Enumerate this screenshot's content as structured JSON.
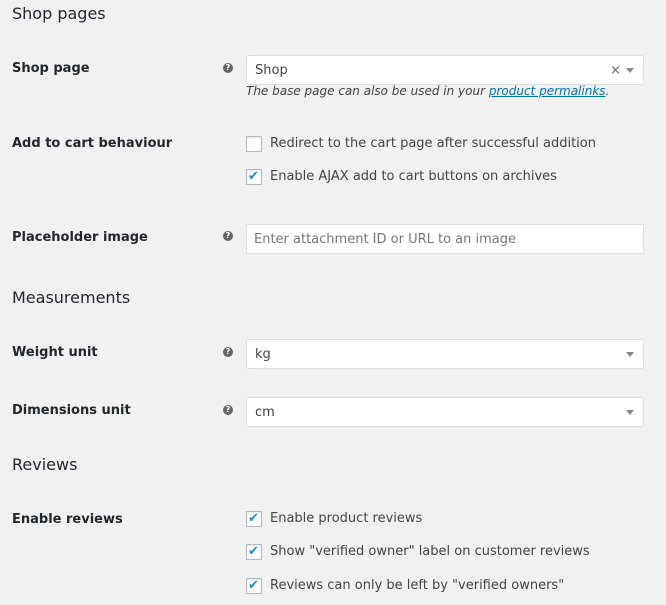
{
  "sections": {
    "shop_pages": "Shop pages",
    "measurements": "Measurements",
    "reviews": "Reviews"
  },
  "help_icon_glyph": "?",
  "shop_page": {
    "label": "Shop page",
    "value": "Shop",
    "clear_glyph": "×",
    "desc_prefix": "The base page can also be used in your ",
    "desc_link": "product permalinks",
    "desc_suffix": "."
  },
  "add_to_cart": {
    "label": "Add to cart behaviour",
    "options": [
      {
        "text": "Redirect to the cart page after successful addition",
        "checked": false
      },
      {
        "text": "Enable AJAX add to cart buttons on archives",
        "checked": true
      }
    ]
  },
  "placeholder_image": {
    "label": "Placeholder image",
    "placeholder": "Enter attachment ID or URL to an image"
  },
  "weight_unit": {
    "label": "Weight unit",
    "value": "kg"
  },
  "dimensions_unit": {
    "label": "Dimensions unit",
    "value": "cm"
  },
  "enable_reviews": {
    "label": "Enable reviews",
    "options": [
      {
        "text": "Enable product reviews",
        "checked": true
      },
      {
        "text": "Show \"verified owner\" label on customer reviews",
        "checked": true
      },
      {
        "text": "Reviews can only be left by \"verified owners\"",
        "checked": true
      }
    ]
  },
  "check_glyph": "✔",
  "colors": {
    "link": "#0073aa",
    "check": "#1e8cbe",
    "background": "#f1f1f1"
  }
}
